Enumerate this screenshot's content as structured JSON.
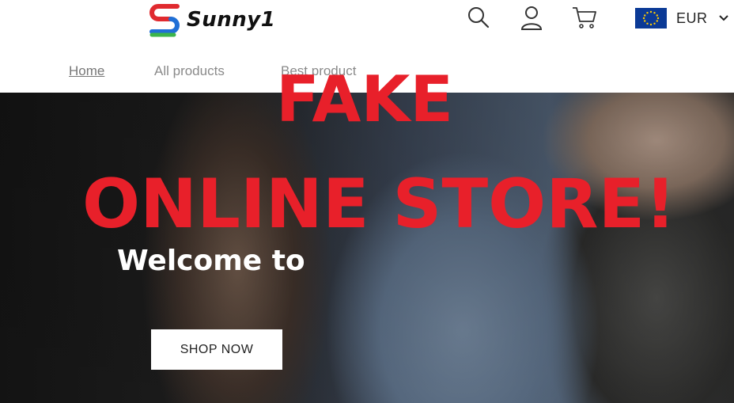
{
  "header": {
    "logo_text": "Sunny1",
    "icons": [
      "search-icon",
      "account-icon",
      "cart-icon"
    ],
    "currency": {
      "label": "EUR",
      "flag": "eu-flag-icon"
    }
  },
  "nav": {
    "items": [
      {
        "label": "Home",
        "active": true
      },
      {
        "label": "All products",
        "active": false
      },
      {
        "label": "Best product",
        "active": false
      }
    ]
  },
  "hero": {
    "warning_line1": "FAKE",
    "warning_line2": "ONLINE STORE!",
    "welcome_text": "Welcome to",
    "cta_label": "SHOP NOW"
  },
  "colors": {
    "warning_red": "#e8202a",
    "logo_red": "#e02a2f",
    "logo_blue": "#1f6fd6",
    "logo_green": "#3bb54a",
    "flag_blue": "#0b3a96",
    "flag_stars": "#ffcc00"
  }
}
